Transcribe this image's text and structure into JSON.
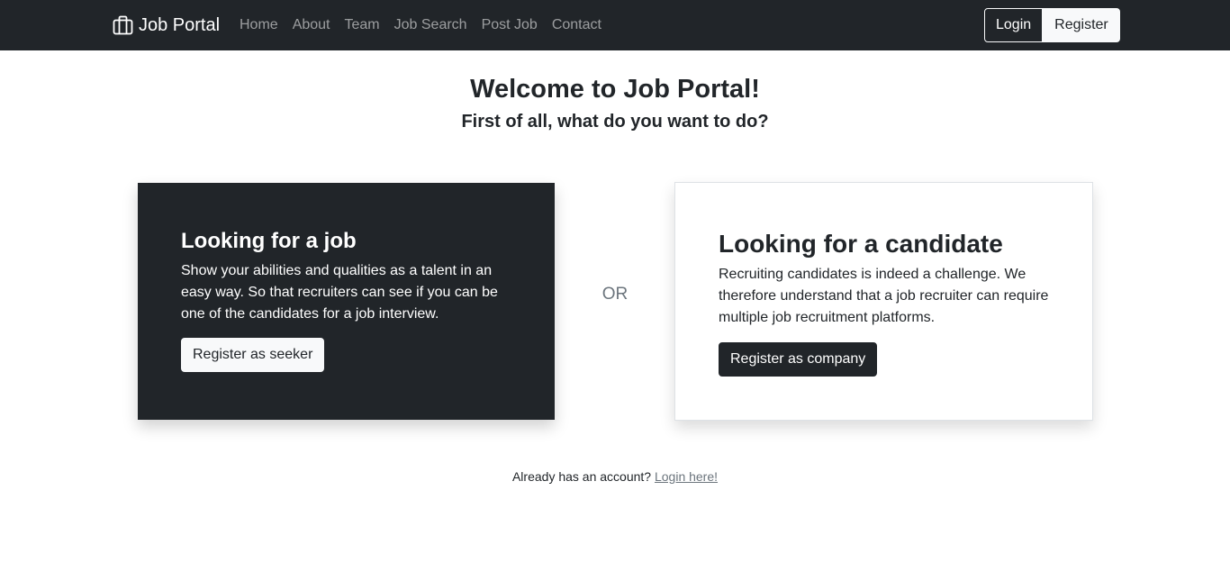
{
  "navbar": {
    "brand_icon": "briefcase-icon",
    "brand": "Job Portal",
    "links": [
      "Home",
      "About",
      "Team",
      "Job Search",
      "Post Job",
      "Contact"
    ],
    "login_label": "Login",
    "register_label": "Register"
  },
  "hero": {
    "title": "Welcome to Job Portal!",
    "subtitle": "First of all, what do you want to do?"
  },
  "seeker_card": {
    "title": "Looking for a job",
    "text": "Show your abilities and qualities as a talent in an easy way. So that recruiters can see if you can be one of the candidates for a job interview.",
    "button": "Register as seeker"
  },
  "separator": "OR",
  "company_card": {
    "title": "Looking for a candidate",
    "text": "Recruiting candidates is indeed a challenge. We therefore understand that a job recruiter can require multiple job recruitment platforms.",
    "button": "Register as company"
  },
  "footer": {
    "prompt": "Already has an account?",
    "link": "Login here!"
  },
  "colors": {
    "dark": "#212529",
    "light": "#f8f9fa",
    "muted": "#6c757d"
  }
}
